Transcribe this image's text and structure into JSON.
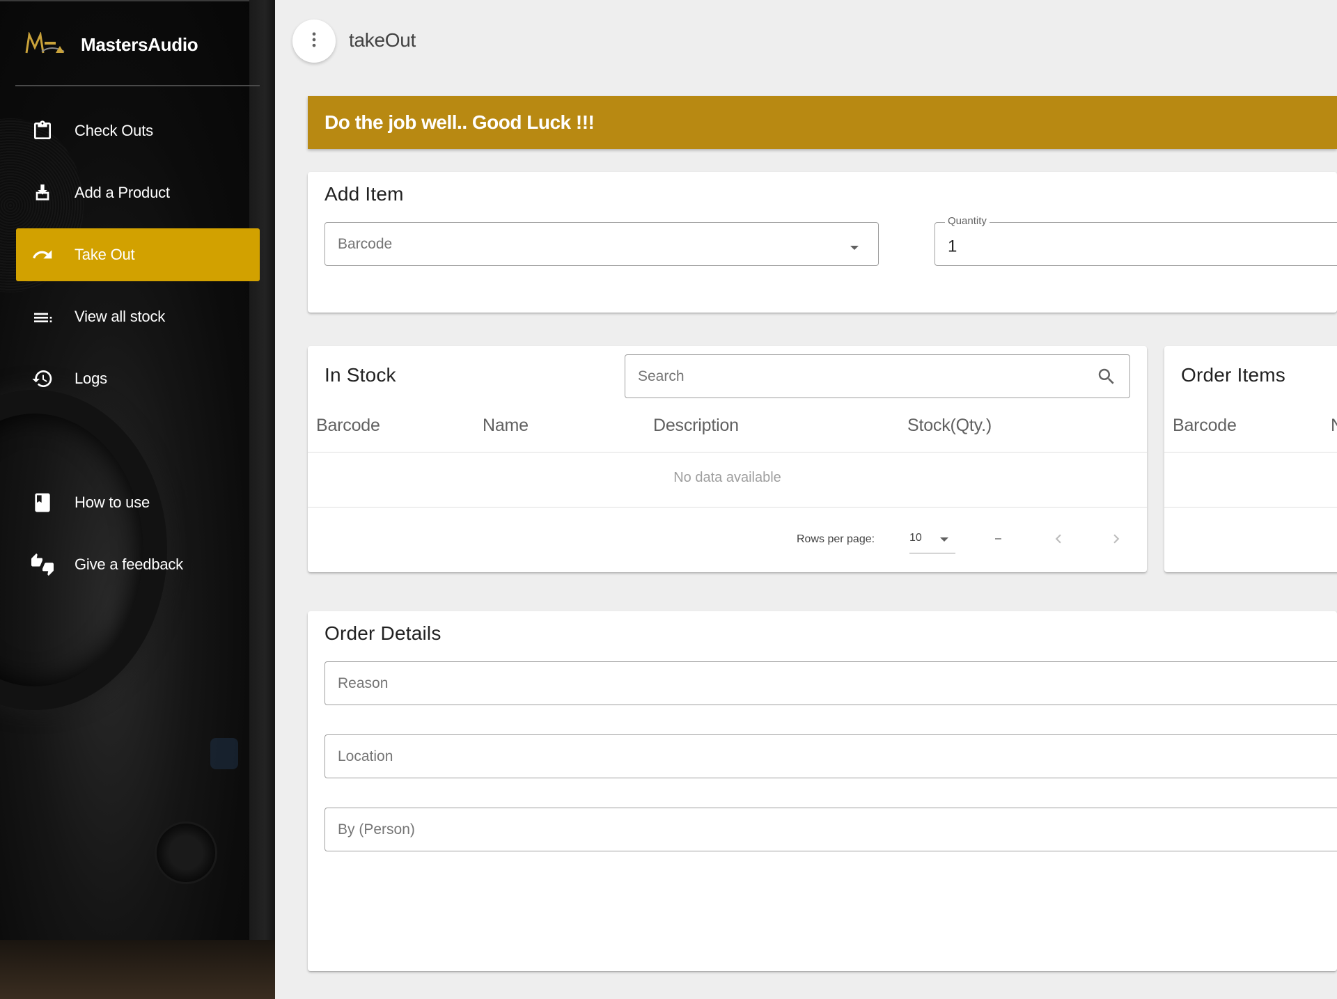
{
  "brand": {
    "name": "MastersAudio",
    "logo_icon": "masters-audio-logo-icon"
  },
  "sidebar": {
    "items": [
      {
        "label": "Check Outs",
        "icon": "clipboard-icon"
      },
      {
        "label": "Add a Product",
        "icon": "download-icon"
      },
      {
        "label": "Take Out",
        "icon": "redo-arrow-icon",
        "active": true
      },
      {
        "label": "View all stock",
        "icon": "list-icon"
      },
      {
        "label": "Logs",
        "icon": "history-icon"
      },
      {
        "label": "How to use",
        "icon": "book-icon"
      },
      {
        "label": "Give a feedback",
        "icon": "thumbs-up-down-icon"
      }
    ]
  },
  "header": {
    "title": "takeOut",
    "menu_icon": "dots-vertical-icon"
  },
  "banner": {
    "text": "Do the job well.. Good Luck !!!"
  },
  "add_item": {
    "title": "Add Item",
    "barcode_placeholder": "Barcode",
    "quantity_label": "Quantity",
    "quantity_value": "1"
  },
  "in_stock": {
    "title": "In Stock",
    "search_placeholder": "Search",
    "columns": [
      "Barcode",
      "Name",
      "Description",
      "Stock(Qty.)"
    ],
    "empty_text": "No data available",
    "footer": {
      "rows_per_page_label": "Rows per page:",
      "rows_per_page_value": "10",
      "page_range": "–"
    }
  },
  "order_items": {
    "title": "Order Items",
    "columns": [
      "Barcode",
      "N"
    ]
  },
  "order_details": {
    "title": "Order Details",
    "reason_placeholder": "Reason",
    "location_placeholder": "Location",
    "person_placeholder": "By (Person)"
  },
  "colors": {
    "accent": "#d2a100",
    "banner": "#b88912",
    "sidebar_bg": "#0c0c0c",
    "page_bg": "#eeeeee"
  }
}
